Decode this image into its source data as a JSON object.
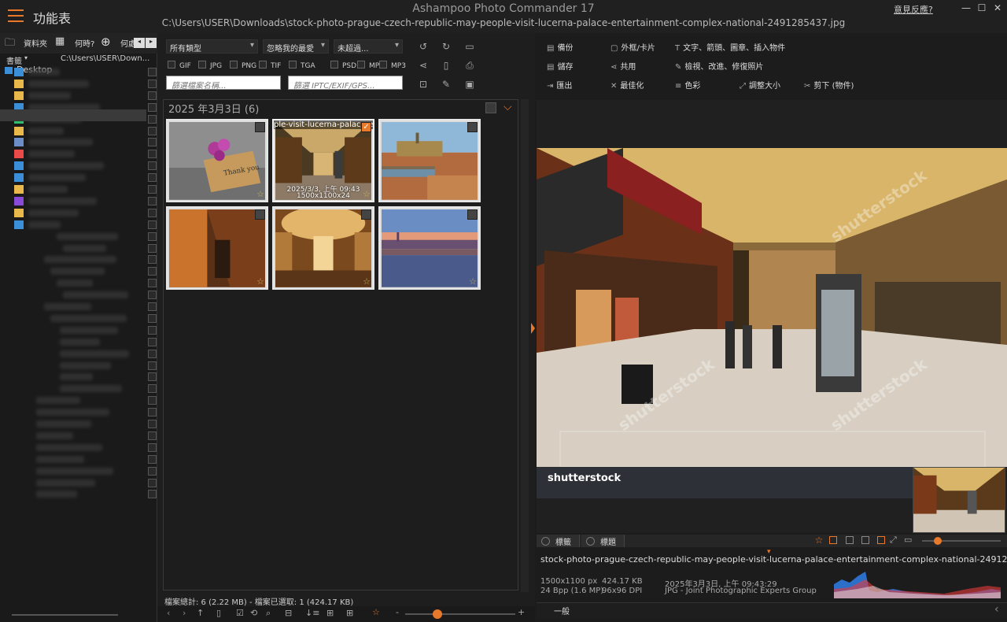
{
  "title_bar": {
    "menu_label": "功能表",
    "app_title": "Ashampoo Photo Commander 17",
    "path": "C:\\Users\\USER\\Downloads\\stock-photo-prague-czech-republic-may-people-visit-lucerna-palace-entertainment-complex-national-2491285437.jpg",
    "feedback": "意見反應?",
    "controls": [
      "minimize",
      "maximize",
      "close"
    ]
  },
  "left_panel": {
    "tabs": [
      "資料夾",
      "何時?",
      "何處"
    ],
    "bookmarks_label": "書籤",
    "path_short": "C:\\Users\\USER\\Down...",
    "root": "Desktop"
  },
  "filters": {
    "type": "所有類型",
    "rating": "忽略我的最愛",
    "age": "未超過...",
    "types": [
      "GIF",
      "JPG",
      "PNG",
      "TIF",
      "TGA",
      "PSD",
      "MP4",
      "MP3"
    ],
    "filename_placeholder": "篩選檔案名稱...",
    "meta_placeholder": "篩選 IPTC/EXIF/GPS..."
  },
  "gallery": {
    "group_title": "2025 年3月3日 (6)",
    "hover_filename": "ple-visit-lucerna-palace-e",
    "hover_date": "2025/3/3, 上午 09:43",
    "hover_dims": "1500x1100x24",
    "status": "檔案總計: 6 (2.22 MB) - 檔案已選取: 1 (424.17 KB)"
  },
  "actions": {
    "backup": "備份",
    "save": "儲存",
    "export": "匯出",
    "frame": "外框/卡片",
    "share": "共用",
    "optimize": "最佳化",
    "text": "文字、箭頭、圖章、插入物件",
    "retouch": "檢視、改進、修復照片",
    "color": "色彩",
    "resize": "調整大小",
    "cut": "剪下 (物件)"
  },
  "viewer": {
    "watermark": "shutterstock",
    "tab_tags": "標籤",
    "tab_title": "標題",
    "filename": "stock-photo-prague-czech-republic-may-people-visit-lucerna-palace-entertainment-complex-national-2491285437.jpg",
    "dims": "1500x1100 px",
    "size": "424.17 KB",
    "date": "2025年3月3日, 上午 09:43:29",
    "bpp": "24 Bpp (1.6 MP)",
    "dpi": "96x96 DPI",
    "format": "JPG - Joint Photographic Experts Group",
    "general": "一般"
  },
  "colors": {
    "accent": "#e8782a",
    "bg": "#1c1c1c"
  }
}
